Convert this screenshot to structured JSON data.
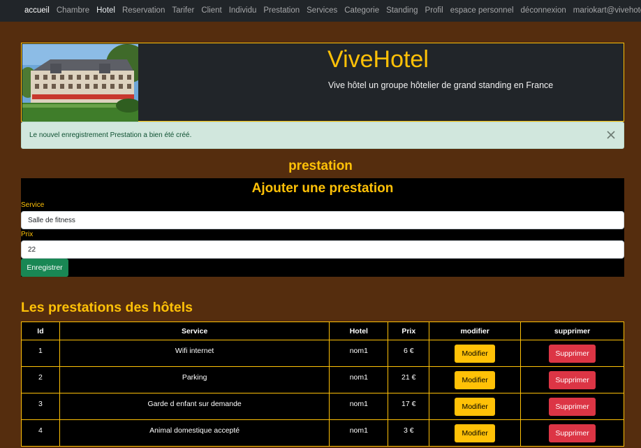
{
  "nav": {
    "items": [
      {
        "label": "accueil",
        "state": "active"
      },
      {
        "label": "Chambre",
        "state": "normal"
      },
      {
        "label": "Hotel",
        "state": "bright"
      },
      {
        "label": "Reservation",
        "state": "normal"
      },
      {
        "label": "Tarifer",
        "state": "normal"
      },
      {
        "label": "Client",
        "state": "normal"
      },
      {
        "label": "Individu",
        "state": "normal"
      },
      {
        "label": "Prestation",
        "state": "normal"
      },
      {
        "label": "Services",
        "state": "normal"
      },
      {
        "label": "Categorie",
        "state": "normal"
      },
      {
        "label": "Standing",
        "state": "normal"
      },
      {
        "label": "Profil",
        "state": "normal"
      },
      {
        "label": "espace personnel",
        "state": "normal"
      },
      {
        "label": "déconnexion",
        "state": "normal"
      },
      {
        "label": "mariokart@vivehotel.fr",
        "state": "normal"
      }
    ]
  },
  "header": {
    "title": "ViveHotel",
    "subtitle": "Vive hôtel un groupe hôtelier de grand standing en France"
  },
  "alert": {
    "message": "Le nouvel enregistrement Prestation a bien été créé."
  },
  "page": {
    "title": "prestation"
  },
  "form": {
    "title": "Ajouter une prestation",
    "service_label": "Service",
    "service_value": "Salle de fitness",
    "prix_label": "Prix",
    "prix_value": "22",
    "submit_label": "Enregistrer"
  },
  "list": {
    "title": "Les prestations des hôtels",
    "headers": [
      "Id",
      "Service",
      "Hotel",
      "Prix",
      "modifier",
      "supprimer"
    ],
    "rows": [
      {
        "id": "1",
        "service": "Wifi internet",
        "hotel": "nom1",
        "prix": "6 €",
        "edit": "Modifier",
        "delete": "Supprimer"
      },
      {
        "id": "2",
        "service": "Parking",
        "hotel": "nom1",
        "prix": "21 €",
        "edit": "Modifier",
        "delete": "Supprimer"
      },
      {
        "id": "3",
        "service": "Garde d enfant sur demande",
        "hotel": "nom1",
        "prix": "17 €",
        "edit": "Modifier",
        "delete": "Supprimer"
      },
      {
        "id": "4",
        "service": "Animal domestique accepté",
        "hotel": "nom1",
        "prix": "3 €",
        "edit": "Modifier",
        "delete": "Supprimer"
      }
    ]
  },
  "colors": {
    "background": "#552d0e",
    "accent": "#ffc107",
    "navbar": "#212529",
    "success": "#198754",
    "danger": "#dc3545"
  }
}
